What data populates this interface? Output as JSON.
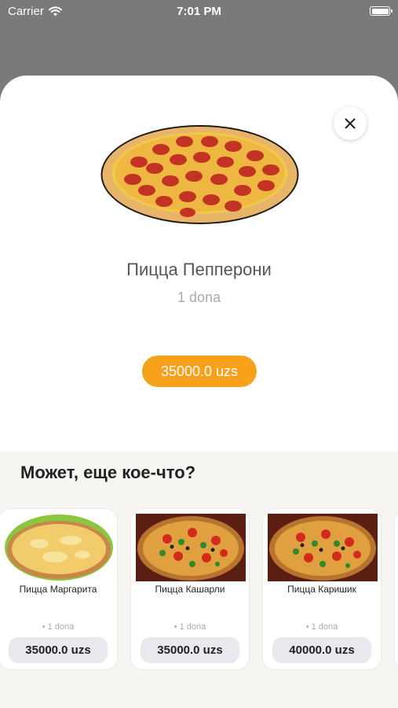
{
  "status_bar": {
    "carrier": "Carrier",
    "time": "7:01 PM"
  },
  "product": {
    "title": "Пицца Пепперони",
    "unit": "1 dona",
    "price": "35000.0 uzs",
    "image_icon": "pepperoni-pizza-image"
  },
  "close_icon": "close-icon",
  "suggestions": {
    "heading": "Может, еще кое-что?",
    "items": [
      {
        "title": "Пицца Маргарита",
        "unit": "• 1 dona",
        "price": "35000.0 uzs"
      },
      {
        "title": "Пицца Кашарли",
        "unit": "• 1 dona",
        "price": "35000.0 uzs"
      },
      {
        "title": "Пицца Каришик",
        "unit": "• 1 dona",
        "price": "40000.0 uzs"
      }
    ]
  },
  "colors": {
    "accent": "#f7a11a",
    "overlay": "#7a7a7a",
    "section_bg": "#f6f5f2"
  }
}
